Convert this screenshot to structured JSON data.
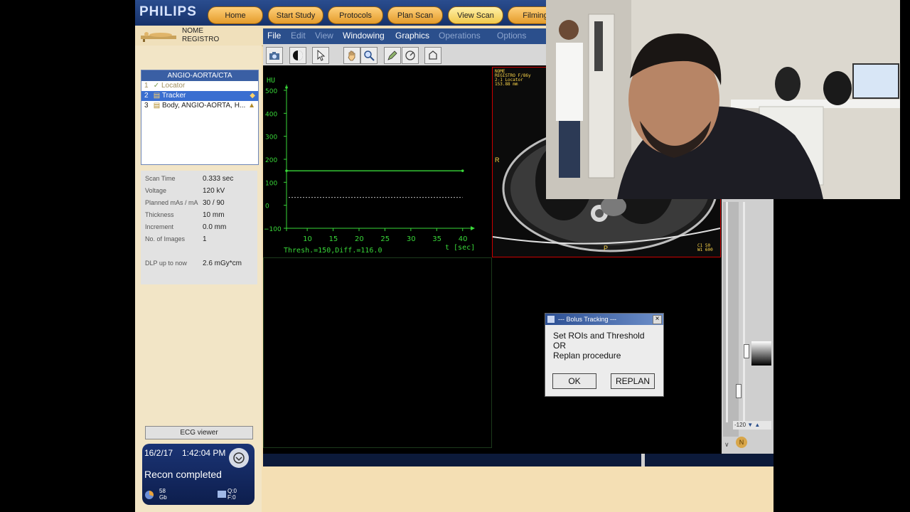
{
  "app": {
    "brand": "PHILIPS",
    "nav": [
      "Home",
      "Start Study",
      "Protocols",
      "Plan Scan",
      "View Scan",
      "Filming"
    ],
    "active_nav": "View Scan"
  },
  "patient": {
    "name": "NOME",
    "registry": "REGISTRO"
  },
  "menubar": {
    "items": [
      {
        "label": "File",
        "enabled": true
      },
      {
        "label": "Edit",
        "enabled": false
      },
      {
        "label": "View",
        "enabled": false
      },
      {
        "label": "Windowing",
        "enabled": true
      },
      {
        "label": "Graphics",
        "enabled": true
      },
      {
        "label": "Operations",
        "enabled": false
      },
      {
        "label": "Options",
        "enabled": false
      }
    ]
  },
  "toolbar": {
    "icons": [
      "camera-icon",
      "contrast-icon",
      "pointer-icon",
      "hand-icon",
      "zoom-icon",
      "pencil-icon",
      "measure-icon",
      "roi-icon"
    ]
  },
  "protocol": {
    "title": "ANGIO-AORTA/CTA",
    "items": [
      {
        "num": "1",
        "label": "Locator",
        "state": "done"
      },
      {
        "num": "2",
        "label": "Tracker",
        "state": "selected"
      },
      {
        "num": "3",
        "label": "Body, ANGIO-AORTA, H...",
        "state": "pending"
      }
    ]
  },
  "scan_params": [
    {
      "label": "Scan Time",
      "value": "0.333 sec"
    },
    {
      "label": "Voltage",
      "value": "120 kV"
    },
    {
      "label": "Planned mAs / mA",
      "value": "30 / 90"
    },
    {
      "label": "Thickness",
      "value": "10 mm"
    },
    {
      "label": "Increment",
      "value": "0.0 mm"
    },
    {
      "label": "No. of Images",
      "value": "1"
    },
    {
      "label": "DLP up to now",
      "value": "2.6 mGy*cm"
    }
  ],
  "ecg_label": "ECG viewer",
  "status": {
    "date": "16/2/17",
    "time": "1:42:04 PM",
    "message": "Recon completed",
    "disk": "58",
    "disk_unit": "Gb",
    "queue_q": "Q:0",
    "queue_f": "F:0"
  },
  "chart_data": {
    "type": "line",
    "ylabel": "HU",
    "xlabel": "t [sec]",
    "yticks": [
      500,
      400,
      300,
      200,
      100,
      0,
      -100
    ],
    "xticks": [
      10,
      15,
      20,
      25,
      30,
      35,
      40
    ],
    "ylim": [
      -100,
      500
    ],
    "xlim": [
      6,
      41
    ],
    "series": [
      {
        "x": [
          6,
          40
        ],
        "y": [
          150,
          150
        ],
        "style": "solid"
      }
    ],
    "baseline": {
      "y": 34,
      "style": "dashed"
    },
    "annotation": "Thresh.=150,Diff.=116.0",
    "color": "#39d839"
  },
  "ct_image": {
    "overlay_lines": [
      "NOME",
      "REGISTRO F/86y",
      "2-1 Locator",
      "153.88 mm"
    ],
    "right_marker": "R",
    "bottom_marker": "P",
    "window_lines": [
      "C1",
      "W1"
    ],
    "window_values": [
      "50",
      "600"
    ]
  },
  "window_readout": "-120",
  "dialog": {
    "title": "--- Bolus Tracking ---",
    "message_lines": [
      "Set ROIs and Threshold",
      "OR",
      "Replan procedure"
    ],
    "ok_label": "OK",
    "replan_label": "REPLAN"
  }
}
